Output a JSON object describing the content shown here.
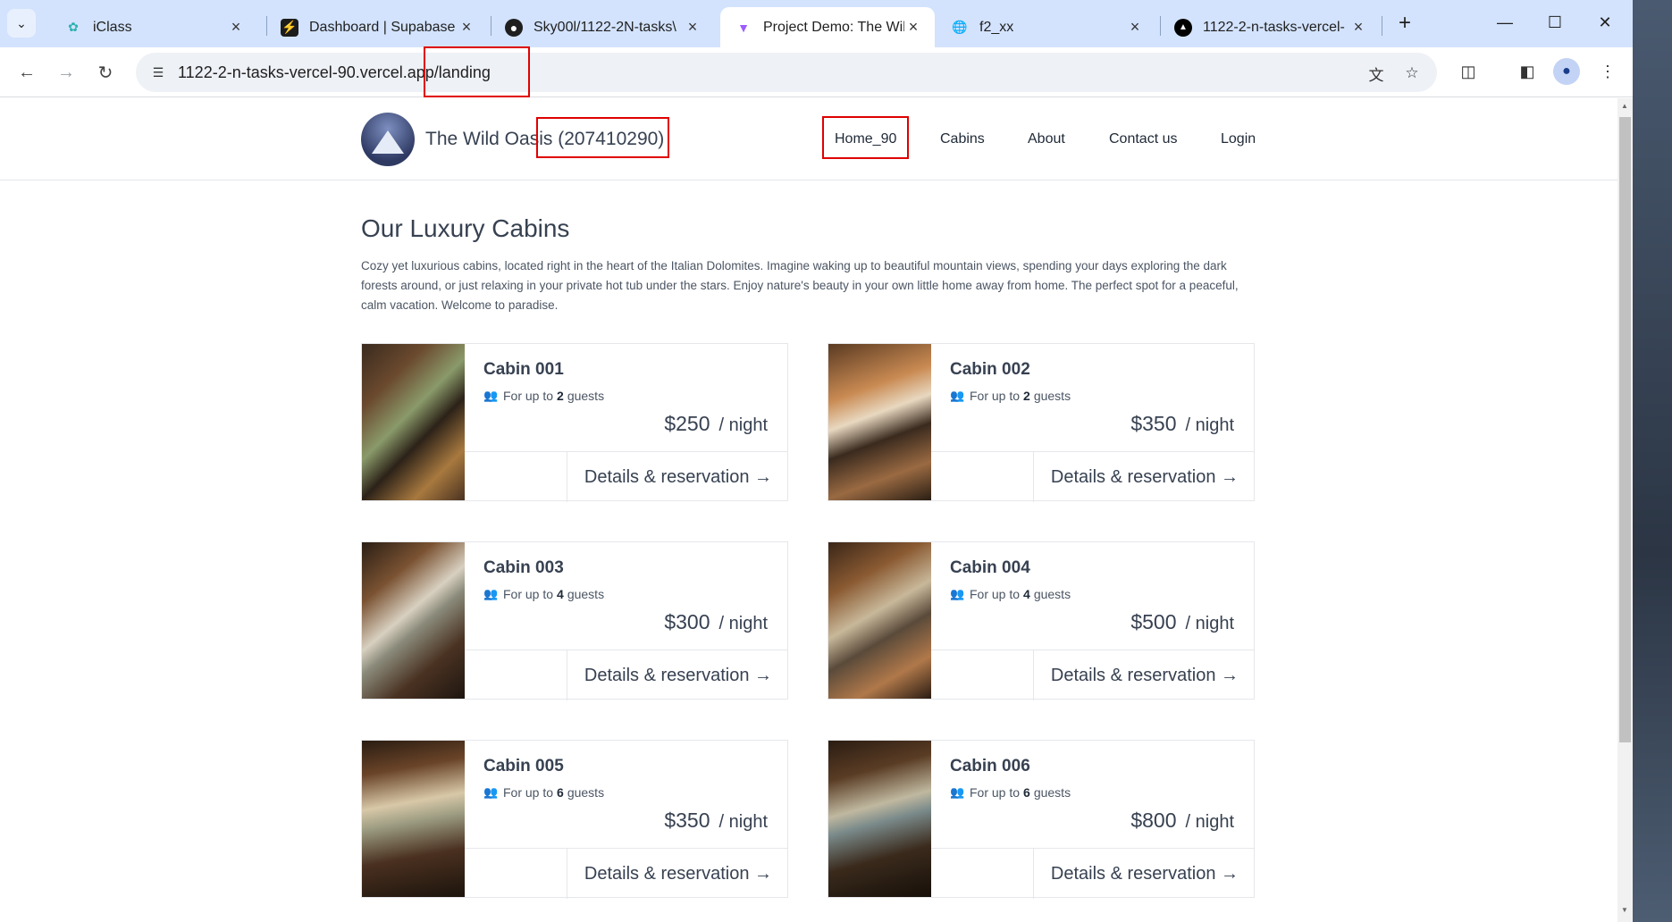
{
  "browser": {
    "tabs": [
      {
        "title": "iClass",
        "icon": "iclass-icon",
        "icon_color": "#2bb0b0"
      },
      {
        "title": "Dashboard | Supabase",
        "icon": "supabase-icon",
        "icon_color": "#3ecf8e"
      },
      {
        "title": "Sky00l/1122-2N-tasks\\",
        "icon": "github-icon",
        "icon_color": "#1f1f1f"
      },
      {
        "title": "Project Demo: The Wild",
        "icon": "vite-icon",
        "icon_color": "#9d5cff",
        "active": true
      },
      {
        "title": "f2_xx",
        "icon": "globe-icon",
        "icon_color": "#5f6368"
      },
      {
        "title": "1122-2-n-tasks-vercel-",
        "icon": "vercel-icon",
        "icon_color": "#000000"
      }
    ],
    "new_tab": "+",
    "url": "1122-2-n-tasks-vercel-90.vercel.app/landing"
  },
  "site": {
    "brand": "The Wild Oasis (207410290)",
    "nav": [
      "Home_90",
      "Cabins",
      "About",
      "Contact us",
      "Login"
    ]
  },
  "main": {
    "heading": "Our Luxury Cabins",
    "intro": "Cozy yet luxurious cabins, located right in the heart of the Italian Dolomites. Imagine waking up to beautiful mountain views, spending your days exploring the dark forests around, or just relaxing in your private hot tub under the stars. Enjoy nature's beauty in your own little home away from home. The perfect spot for a peaceful, calm vacation. Welcome to paradise."
  },
  "cabins": [
    {
      "name": "Cabin 001",
      "guests_prefix": "For up to",
      "guests": "2",
      "guests_suffix": "guests",
      "price": "$250",
      "per": "/ night",
      "cta": "Details & reservation →"
    },
    {
      "name": "Cabin 002",
      "guests_prefix": "For up to",
      "guests": "2",
      "guests_suffix": "guests",
      "price": "$350",
      "per": "/ night",
      "cta": "Details & reservation →"
    },
    {
      "name": "Cabin 003",
      "guests_prefix": "For up to",
      "guests": "4",
      "guests_suffix": "guests",
      "price": "$300",
      "per": "/ night",
      "cta": "Details & reservation →"
    },
    {
      "name": "Cabin 004",
      "guests_prefix": "For up to",
      "guests": "4",
      "guests_suffix": "guests",
      "price": "$500",
      "per": "/ night",
      "cta": "Details & reservation →"
    },
    {
      "name": "Cabin 005",
      "guests_prefix": "For up to",
      "guests": "6",
      "guests_suffix": "guests",
      "price": "$350",
      "per": "/ night",
      "cta": "Details & reservation →"
    },
    {
      "name": "Cabin 006",
      "guests_prefix": "For up to",
      "guests": "6",
      "guests_suffix": "guests",
      "price": "$800",
      "per": "/ night",
      "cta": "Details & reservation →"
    }
  ],
  "colors": {
    "annotation_box": "#e00000",
    "tabbar": "#d3e3fd"
  }
}
